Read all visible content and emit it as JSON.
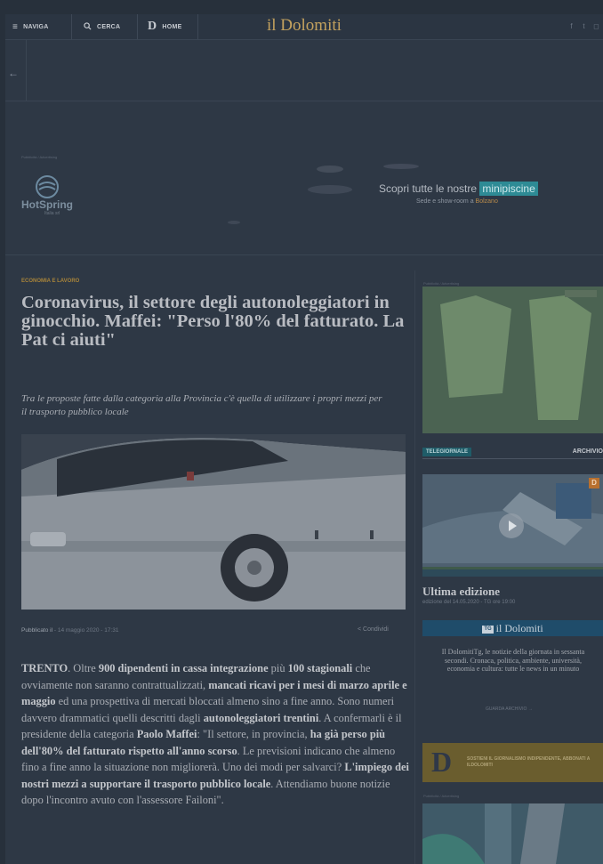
{
  "header": {
    "nav_label": "NAVIGA",
    "search_label": "CERCA",
    "home_label": "HOME",
    "brand": "il Dolomiti"
  },
  "ad_top": {
    "small": "Pubblicità / Advertising",
    "brand": "HotSpring",
    "brand_sub": "Italia srl",
    "text": "Scopri tutte le nostre",
    "highlight": "minipiscine",
    "sub": "Sede e show-room a",
    "sub_loc": "Bolzano"
  },
  "article": {
    "kicker": "ECONOMIA E LAVORO",
    "title": "Coronavirus, il settore degli autonoleggiatori in ginocchio. Maffei: \"Perso l'80% del fatturato. La Pat ci aiuti\"",
    "subtitle": "Tra le proposte fatte dalla categoria alla Provincia c'è quella di utilizzare i propri mezzi per il trasporto pubblico locale",
    "published_label": "Pubblicato il",
    "published_date": "- 14 maggio 2020 - 17:31",
    "share": "Condividi",
    "body": {
      "p1": "TRENTO",
      "p2": ". Oltre ",
      "p3": "900 dipendenti in cassa integrazione",
      "p4": " più ",
      "p5": "100 stagionali",
      "p6": " che ovviamente non saranno contrattualizzati, ",
      "p7": "mancati ricavi per i mesi di marzo aprile e maggio",
      "p8": " ed una prospettiva di mercati bloccati almeno sino a fine anno. Sono numeri davvero drammatici quelli descritti dagli ",
      "p9": "autonoleggiatori trentini",
      "p10": ". A confermarli è il presidente della categoria ",
      "p11": "Paolo Maffei",
      "p12": ": \"Il settore, in provincia, ",
      "p13": "ha già perso più dell'80% del fatturato rispetto all'anno scorso",
      "p14": ". Le previsioni indicano che almeno fino a fine anno la situazione non migliorerà. Uno dei modi per salvarci? ",
      "p15": "L'impiego dei nostri mezzi a supportare il trasporto pubblico locale",
      "p16": ". Attendiamo buone notizie dopo l'incontro avuto con l'assessore Failoni\"."
    }
  },
  "sidebar": {
    "ad_label": "Pubblicità / Advertising",
    "ad2_label": "Pubblicità / Advertising",
    "tg_badge": "TELEGIORNALE",
    "archive": "ARCHIVIO",
    "edition_title": "Ultima edizione",
    "edition_sub": "edizione del 14.05.2020 - TG ore 19:00",
    "tg_icon": "TG",
    "tg_brand": "il Dolomiti",
    "tg_desc": "Il DolomitiTg, le notizie della giornata in sessanta secondi. Cronaca, politica, ambiente, università, economia e cultura: tutte le news in un minuto",
    "tg_more": "GUARDA ARCHIVIO →",
    "promo_letter": "D",
    "promo_text": "SOSTIENI IL GIORNALISMO INDIPENDENTE, ABBONATI A ILDOLOMITI",
    "video_badge": "D"
  },
  "colors": {
    "accent": "#c4a25e",
    "teal": "#2e8b95",
    "tg_blue": "#1f4c6a"
  }
}
